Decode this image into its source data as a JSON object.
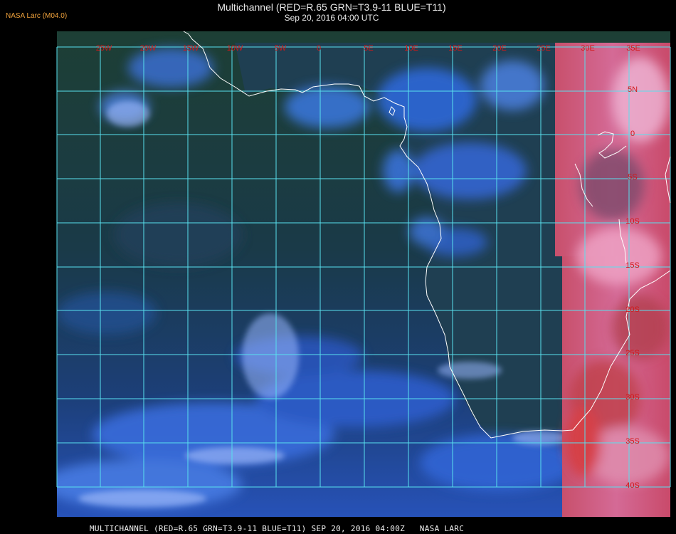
{
  "header": {
    "producer": "NASA Larc (M04.0)",
    "title": "Multichannel (RED=R.65 GRN=T3.9-11 BLUE=T11)",
    "datetime": "Sep 20, 2016 04:00 UTC"
  },
  "footer": {
    "caption": "MULTICHANNEL (RED=R.65 GRN=T3.9-11 BLUE=T11) SEP 20, 2016 04:00Z   NASA LARC"
  },
  "grid": {
    "lon_labels": [
      "25W",
      "20W",
      "15W",
      "10W",
      "5W",
      "0",
      "5E",
      "10E",
      "15E",
      "20E",
      "25E",
      "30E",
      "35E"
    ],
    "lat_labels": [
      "5N",
      "0",
      "5S",
      "10S",
      "15S",
      "20S",
      "25S",
      "30S",
      "35S",
      "40S"
    ]
  },
  "colors": {
    "grid_line": "#58e0ee",
    "label": "#d21818",
    "coastline": "#ffffff",
    "producer_text": "#f0a23c"
  }
}
